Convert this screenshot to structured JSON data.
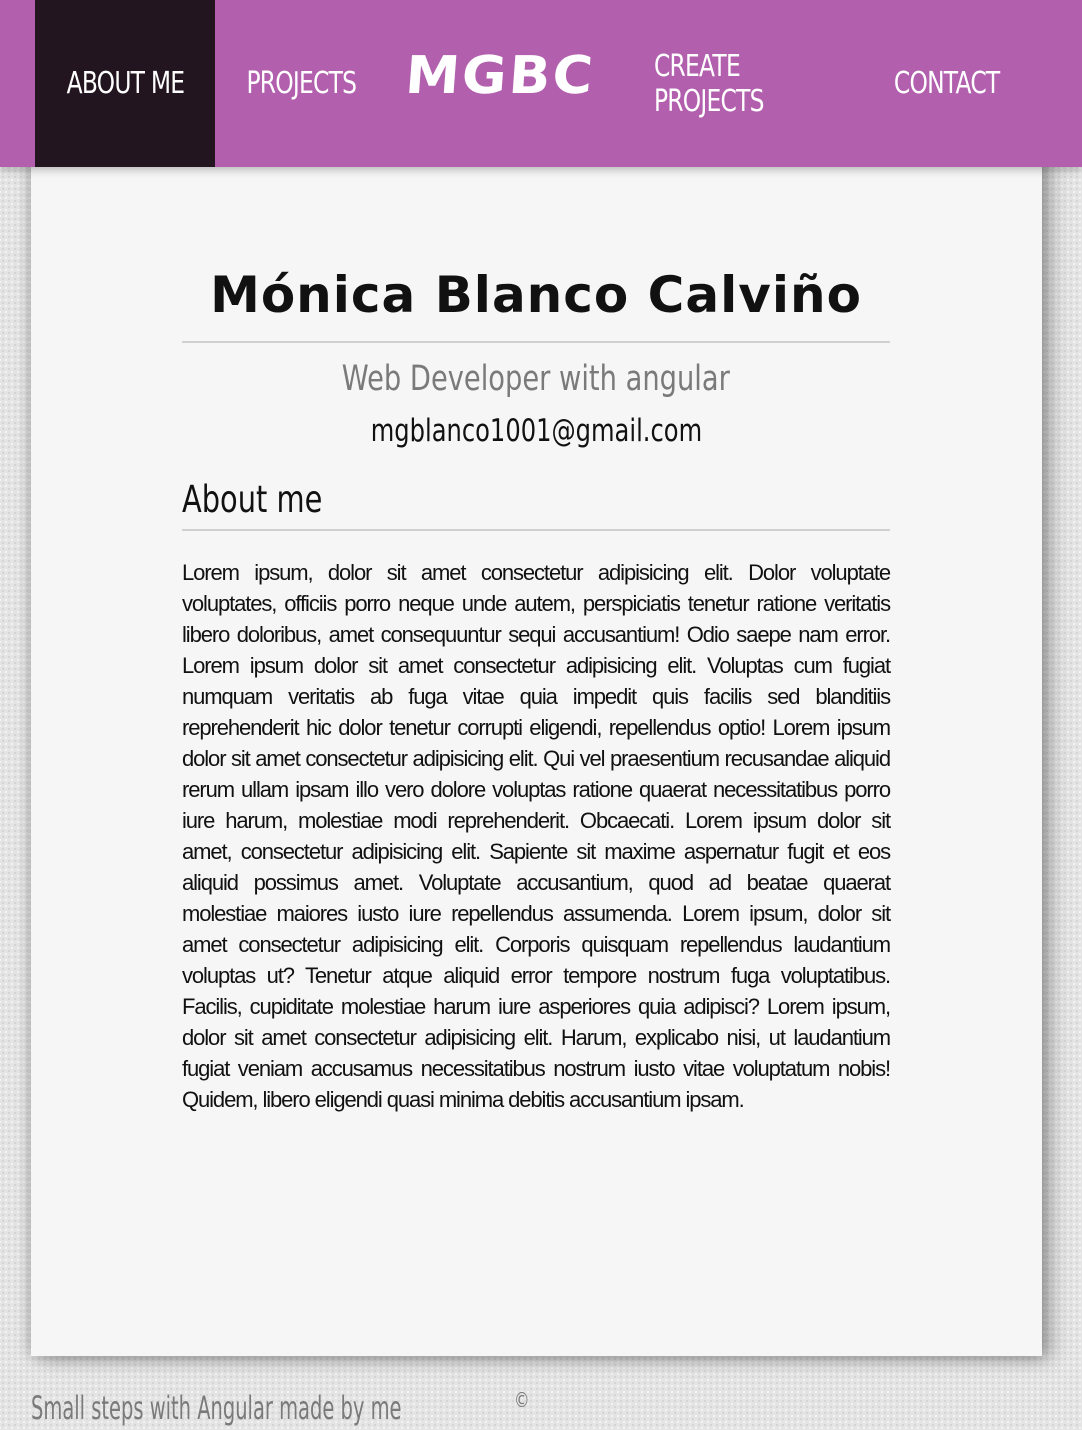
{
  "nav": {
    "about_me": "ABOUT ME",
    "projects": "PROJECTS",
    "logo": "MGBC",
    "create_projects": "CREATE PROJECTS",
    "contact": "CONTACT",
    "active_item": "about_me"
  },
  "profile": {
    "name": "Mónica Blanco Calviño",
    "role": "Web Developer with angular",
    "email": "mgblanco1001@gmail.com"
  },
  "about": {
    "heading": "About me",
    "text": "Lorem ipsum, dolor sit amet consectetur adipisicing elit. Dolor voluptate voluptates, officiis porro neque unde autem, perspiciatis tenetur ratione veritatis libero doloribus, amet consequuntur sequi accusantium! Odio saepe nam error. Lorem ipsum dolor sit amet consectetur adipisicing elit. Voluptas cum fugiat numquam veritatis ab fuga vitae quia impedit quis facilis sed blanditiis reprehenderit hic dolor tenetur corrupti eligendi, repellendus optio! Lorem ipsum dolor sit amet consectetur adipisicing elit. Qui vel praesentium recusandae aliquid rerum ullam ipsam illo vero dolore voluptas ratione quaerat necessitatibus porro iure harum, molestiae modi reprehenderit. Obcaecati. Lorem ipsum dolor sit amet, consectetur adipisicing elit. Sapiente sit maxime aspernatur fugit et eos aliquid possimus amet. Voluptate accusantium, quod ad beatae quaerat molestiae maiores iusto iure repellendus assumenda. Lorem ipsum, dolor sit amet consectetur adipisicing elit. Corporis quisquam repellendus laudantium voluptas ut? Tenetur atque aliquid error tempore nostrum fuga voluptatibus. Facilis, cupiditate molestiae harum iure asperiores quia adipisci? Lorem ipsum, dolor sit amet consectetur adipisicing elit. Harum, explicabo nisi, ut laudantium fugiat veniam accusamus necessitatibus nostrum iusto vitae voluptatum nobis! Quidem, libero eligendi quasi minima debitis accusantium ipsam."
  },
  "footer": {
    "text": "Small steps with Angular made by me",
    "symbol": "©"
  },
  "colors": {
    "navbar": "#b260ae",
    "nav_active": "#231520",
    "card": "#f6f6f6",
    "muted_text": "#7a7a7a"
  }
}
